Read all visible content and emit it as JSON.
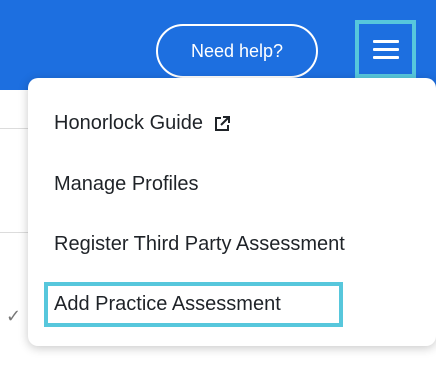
{
  "header": {
    "help_label": "Need help?",
    "menu_icon": "hamburger-icon"
  },
  "background": {
    "check_icon": "checkmark-icon"
  },
  "menu": {
    "items": [
      {
        "label": "Honorlock Guide",
        "icon": "external-link-icon"
      },
      {
        "label": "Manage Profiles"
      },
      {
        "label": "Register Third Party Assessment"
      },
      {
        "label": "Add Practice Assessment",
        "highlighted": true
      }
    ]
  },
  "colors": {
    "header_blue": "#1d6fe0",
    "highlight_cyan": "#57c7dc",
    "text_dark": "#1f2328"
  }
}
